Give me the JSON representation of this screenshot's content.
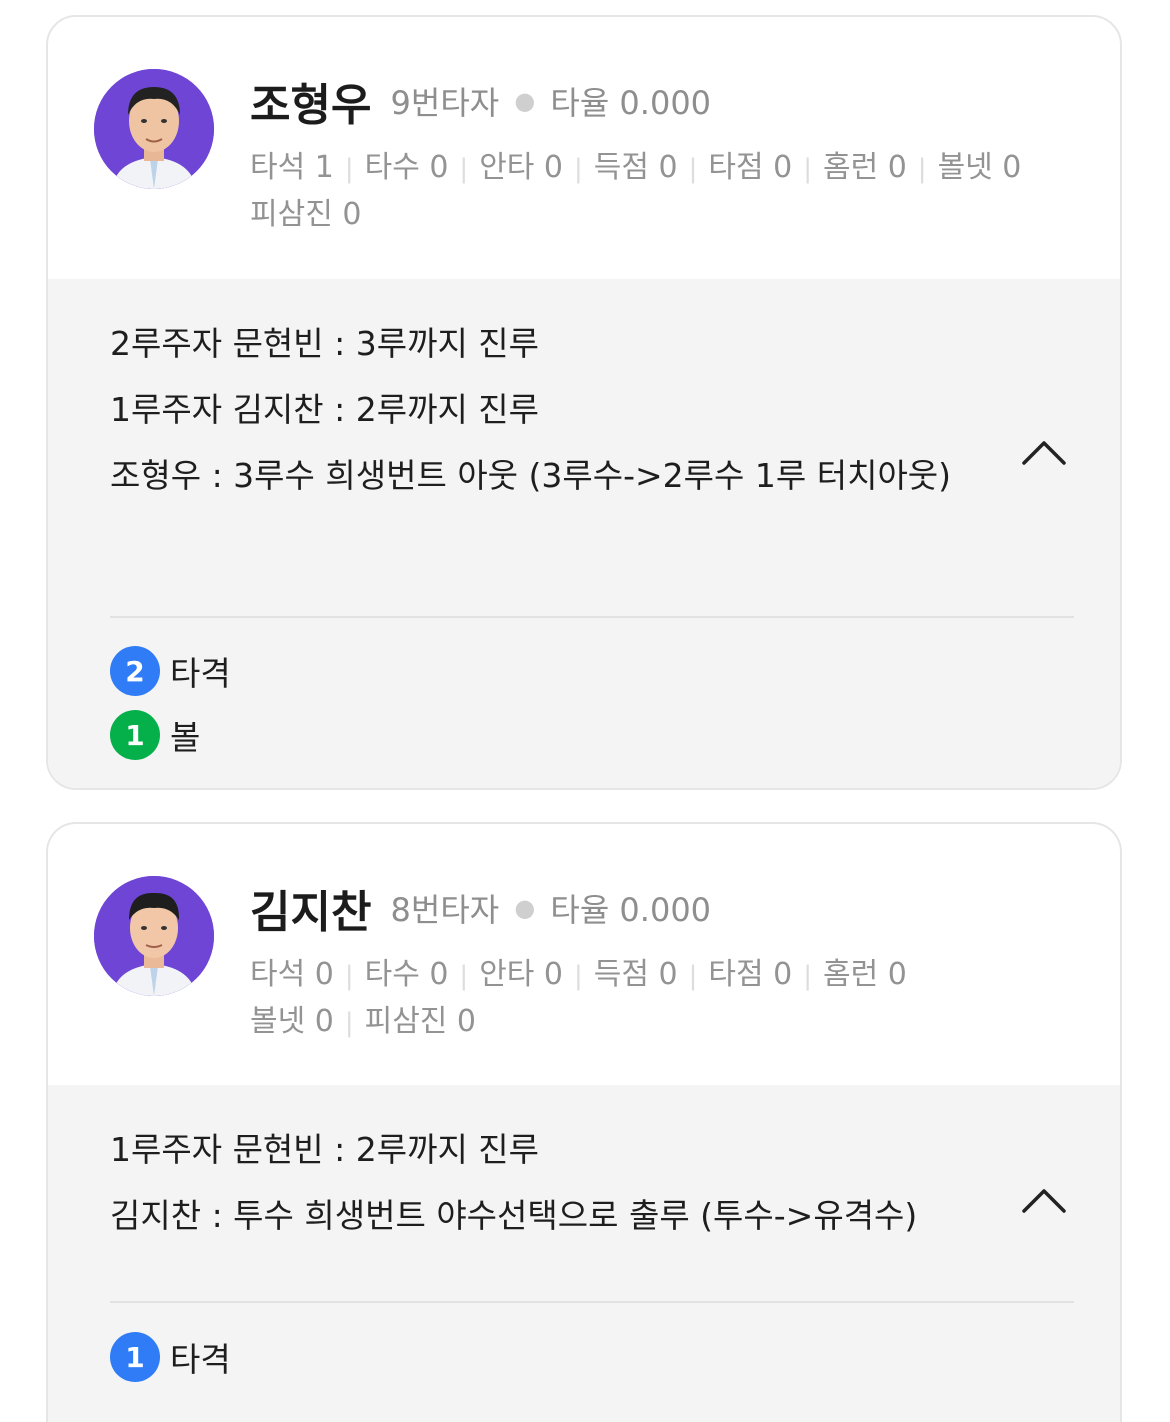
{
  "cards": [
    {
      "name": "조형우",
      "order": "9번타자",
      "avg": "타율 0.000",
      "stats": [
        "타석 1",
        "타수 0",
        "안타 0",
        "득점 0",
        "타점 0",
        "홈런 0",
        "볼넷 0",
        "피삼진 0"
      ],
      "events": [
        "2루주자 문현빈 : 3루까지 진루",
        "1루주자 김지찬 : 2루까지 진루",
        "조형우 : 3루수 희생번트 아웃 (3루수->2루수 1루 터치아웃)"
      ],
      "pitches": [
        {
          "num": "2",
          "label": "타격",
          "color": "#2f7cf6"
        },
        {
          "num": "1",
          "label": "볼",
          "color": "#05b04b"
        }
      ]
    },
    {
      "name": "김지찬",
      "order": "8번타자",
      "avg": "타율 0.000",
      "stats": [
        "타석 0",
        "타수 0",
        "안타 0",
        "득점 0",
        "타점 0",
        "홈런 0",
        "볼넷 0",
        "피삼진 0"
      ],
      "events": [
        "1루주자 문현빈 : 2루까지 진루",
        "김지찬 : 투수 희생번트 야수선택으로 출루 (투수->유격수)"
      ],
      "pitches": [
        {
          "num": "1",
          "label": "타격",
          "color": "#2f7cf6"
        }
      ]
    }
  ],
  "icons": {
    "avatar": "player-photo",
    "toggle": "chevron-up-icon"
  },
  "colors": {
    "avatar_bg": "#6f45d6",
    "hit_badge": "#2f7cf6",
    "ball_badge": "#05b04b",
    "panel_bg": "#f4f4f4"
  }
}
